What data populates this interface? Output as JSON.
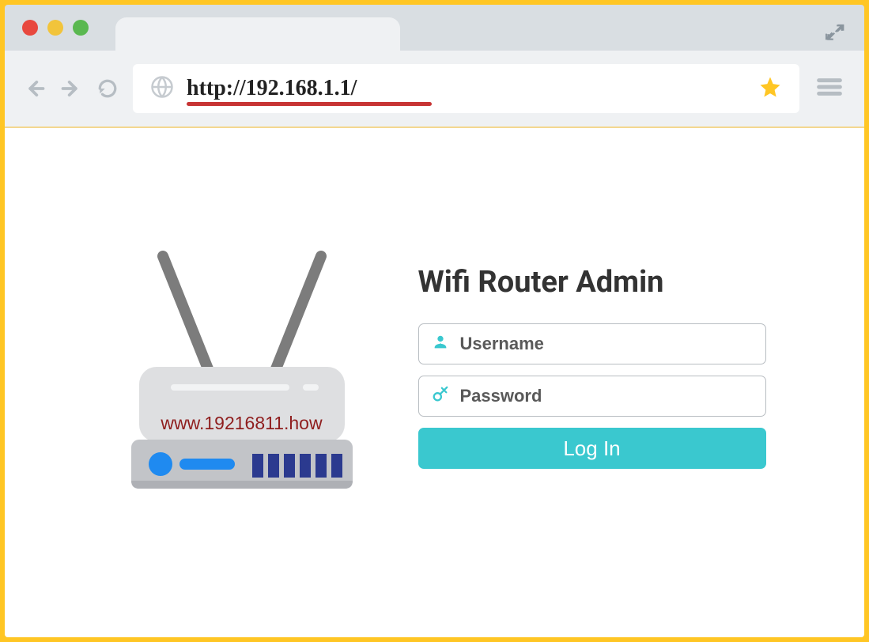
{
  "browser": {
    "url": "http://192.168.1.1/"
  },
  "router": {
    "label": "www.19216811.how"
  },
  "login": {
    "title": "Wifi Router Admin",
    "username_placeholder": "Username",
    "password_placeholder": "Password",
    "button_label": "Log In"
  }
}
